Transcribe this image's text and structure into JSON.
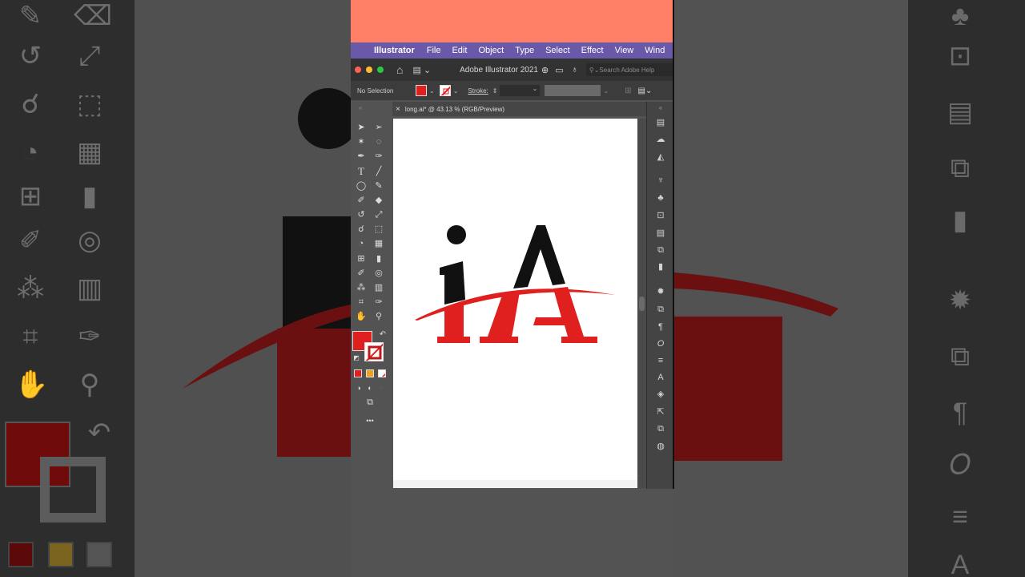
{
  "menubar": {
    "app_name": "Illustrator",
    "items": [
      "File",
      "Edit",
      "Object",
      "Type",
      "Select",
      "Effect",
      "View",
      "Wind"
    ]
  },
  "titlebar": {
    "title": "Adobe Illustrator 2021",
    "search_placeholder": "Search Adobe Help"
  },
  "controlbar": {
    "selection_label": "No Selection",
    "stroke_label": "Stroke:"
  },
  "document_tab": {
    "close": "×",
    "title": "long.ai* @ 43.13 % (RGB/Preview)"
  },
  "colors": {
    "fill": "#e0201e",
    "accent_peach": "#ff8066",
    "menubar": "#6a59a8",
    "logo_red": "#e0201e",
    "logo_black": "#111111"
  },
  "toolbar": {
    "more_tools": "•••"
  },
  "artwork": {
    "logo_text_i": "i",
    "logo_text_lambda": "Λ",
    "logo_text_bottom": "IA"
  }
}
